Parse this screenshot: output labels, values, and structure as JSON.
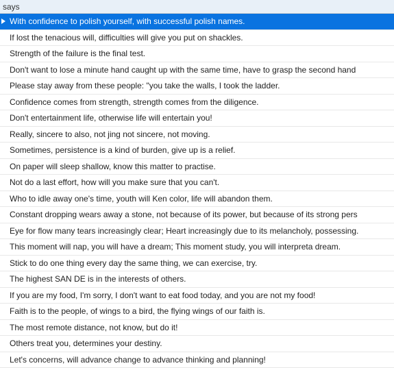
{
  "header": "says",
  "rows": [
    {
      "text": "With confidence to polish yourself, with successful polish names.",
      "selected": true
    },
    {
      "text": "If lost the tenacious will, difficulties will give you put on shackles.",
      "selected": false
    },
    {
      "text": "Strength of the failure is the final test.",
      "selected": false
    },
    {
      "text": "Don't want to lose a minute hand caught up with the same time, have to grasp the second hand",
      "selected": false
    },
    {
      "text": "Please stay away from these people: \"you take the walls, I took the ladder.",
      "selected": false
    },
    {
      "text": "Confidence comes from strength, strength comes from the diligence.",
      "selected": false
    },
    {
      "text": "Don't entertainment life, otherwise life will entertain you!",
      "selected": false
    },
    {
      "text": "Really, sincere to also, not jing not sincere, not moving.",
      "selected": false
    },
    {
      "text": "Sometimes, persistence is a kind of burden, give up is a relief.",
      "selected": false
    },
    {
      "text": "On paper will sleep shallow, know this matter to practise.",
      "selected": false
    },
    {
      "text": "Not do a last effort, how will you make sure that you can't.",
      "selected": false
    },
    {
      "text": "Who to idle away one's time, youth will Ken color, life will abandon them.",
      "selected": false
    },
    {
      "text": "Constant dropping wears away a stone, not because of its power, but because of its strong pers",
      "selected": false
    },
    {
      "text": "Eye for flow many tears increasingly clear; Heart increasingly due to its melancholy, possessing.",
      "selected": false
    },
    {
      "text": "This moment will nap, you will have a dream; This moment study, you will interpreta dream.",
      "selected": false
    },
    {
      "text": "Stick to do one thing every day the same thing, we can exercise, try.",
      "selected": false
    },
    {
      "text": "The highest SAN DE is in the interests of others.",
      "selected": false
    },
    {
      "text": "If you are my food, I'm sorry, I don't want to eat food today, and you are not my food!",
      "selected": false
    },
    {
      "text": "Faith is to the people, of wings to a bird, the flying wings of our faith is.",
      "selected": false
    },
    {
      "text": "The most remote distance, not know, but do it!",
      "selected": false
    },
    {
      "text": "Others treat you, determines your destiny.",
      "selected": false
    },
    {
      "text": "Let's concerns, will advance change to advance thinking and planning!",
      "selected": false
    }
  ]
}
